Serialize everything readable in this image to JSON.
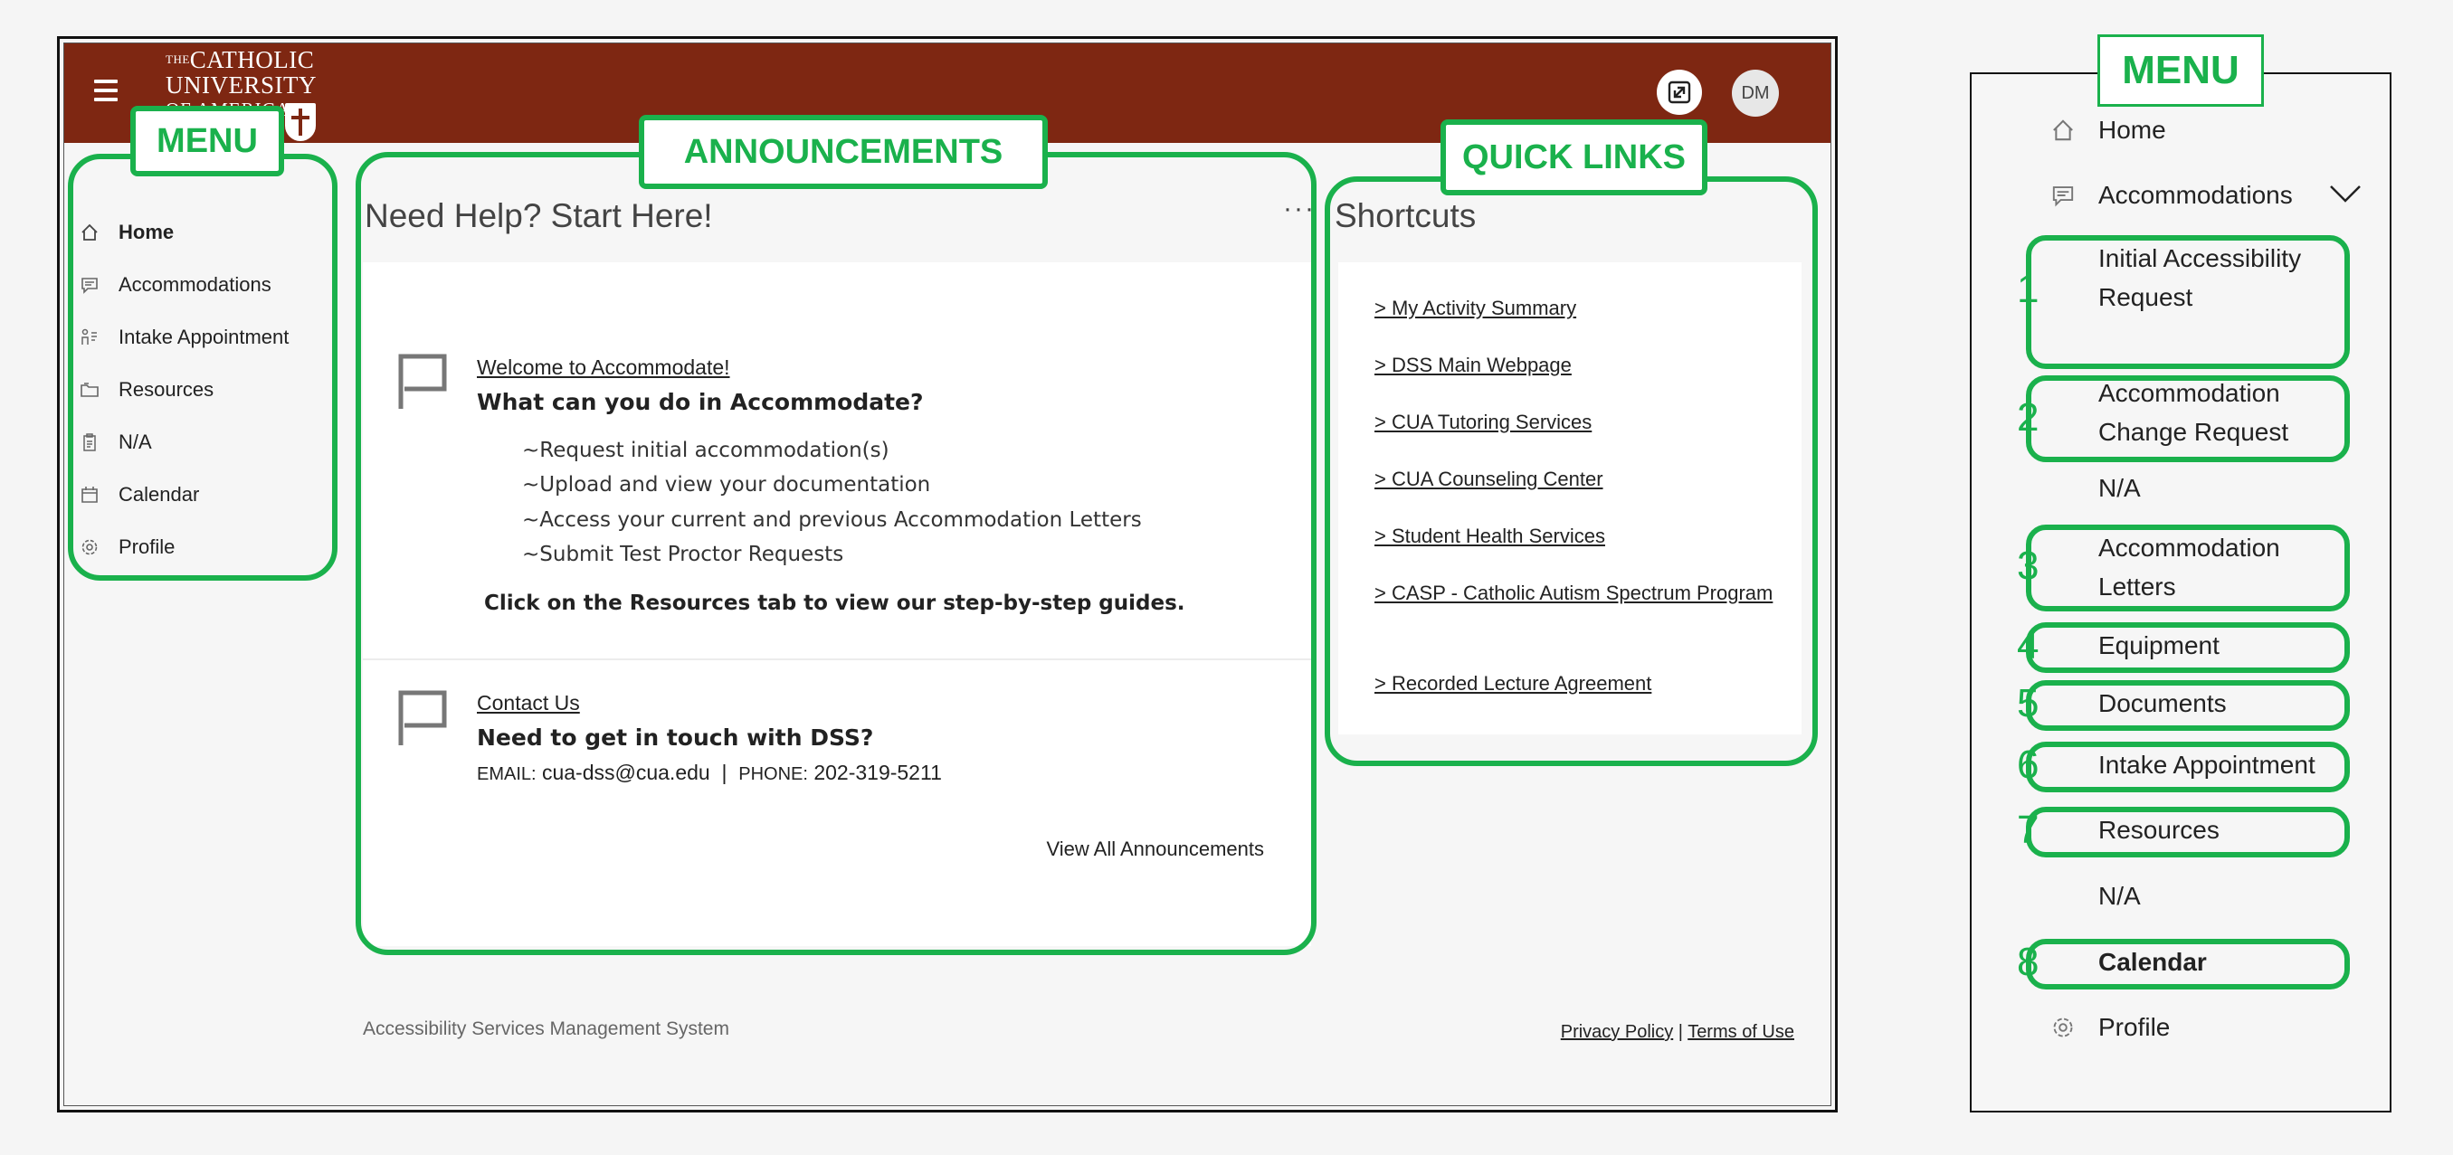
{
  "app": {
    "logo_lines": [
      "THE",
      "CATHOLIC",
      "UNIVERSITY",
      "OF AMERICA"
    ],
    "user_initials": "DM",
    "brand_color": "#7e2712",
    "annotation_color": "#1ab14c"
  },
  "annotation_labels": {
    "menu": "MENU",
    "announcements": "ANNOUNCEMENTS",
    "quick_links": "QUICK LINKS",
    "menu_panel": "MENU"
  },
  "sidebar": {
    "items": [
      {
        "label": "Home",
        "icon": "home-icon"
      },
      {
        "label": "Accommodations",
        "icon": "chat-icon"
      },
      {
        "label": "Intake Appointment",
        "icon": "intake-icon"
      },
      {
        "label": "Resources",
        "icon": "folder-icon"
      },
      {
        "label": "N/A",
        "icon": "clipboard-icon"
      },
      {
        "label": "Calendar",
        "icon": "calendar-icon"
      },
      {
        "label": "Profile",
        "icon": "gear-icon"
      }
    ]
  },
  "announcements": {
    "section_title": "Need Help? Start Here!",
    "more_label": "···",
    "welcome": {
      "link": "Welcome to Accommodate!",
      "heading": "What can you do in Accommodate?",
      "bullets": [
        "~Request initial accommodation(s)",
        "~Upload and view your documentation",
        "~Access your current and previous Accommodation Letters",
        "~Submit Test Proctor Requests"
      ],
      "cta": "Click on the Resources tab to view our step-by-step guides."
    },
    "contact": {
      "link": "Contact Us",
      "heading": "Need to get in touch with DSS?",
      "email_label": "EMAIL:",
      "email": "cua-dss@cua.edu",
      "separator": "|",
      "phone_label": "PHONE:",
      "phone": "202-319-5211"
    },
    "view_all": "View All Announcements"
  },
  "shortcuts": {
    "title": "Shortcuts",
    "links": [
      "> My Activity Summary",
      "> DSS Main Webpage",
      "> CUA Tutoring Services",
      "> CUA Counseling Center",
      "> Student Health Services",
      "> CASP - Catholic Autism Spectrum Program",
      "> Recorded Lecture Agreement"
    ]
  },
  "footer": {
    "system_name": "Accessibility Services Management System",
    "privacy": "Privacy Policy",
    "separator": "|",
    "terms": "Terms of Use"
  },
  "menu_panel": {
    "home": "Home",
    "accommodations": "Accommodations",
    "items": [
      {
        "num": "1",
        "label": "Initial Accessibility Request"
      },
      {
        "num": "2",
        "label": "Accommodation Change Request"
      },
      {
        "num": "",
        "label": "N/A"
      },
      {
        "num": "3",
        "label": "Accommodation Letters"
      },
      {
        "num": "4",
        "label": "Equipment"
      },
      {
        "num": "5",
        "label": "Documents"
      },
      {
        "num": "6",
        "label": "Intake Appointment"
      },
      {
        "num": "7",
        "label": "Resources"
      },
      {
        "num": "",
        "label": "N/A"
      },
      {
        "num": "8",
        "label": "Calendar"
      }
    ],
    "profile": "Profile"
  }
}
